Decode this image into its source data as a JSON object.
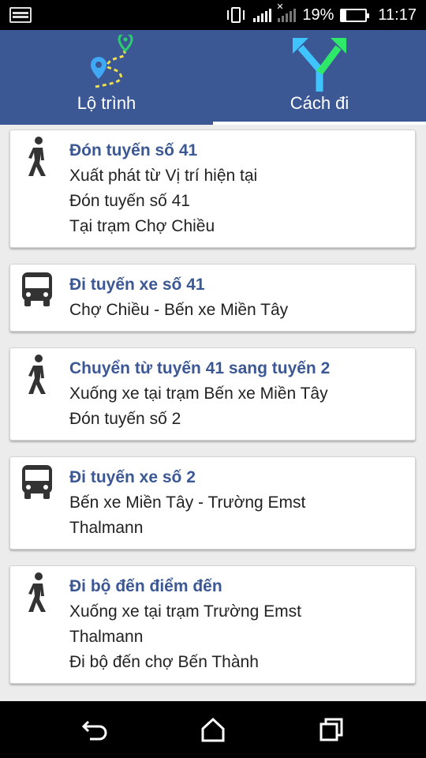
{
  "status_bar": {
    "battery_percent": "19%",
    "battery_level": 0.19,
    "time": "11:17",
    "icons": [
      "notification-icon",
      "vibrate-icon",
      "signal-icon",
      "no-signal-icon",
      "battery-icon"
    ]
  },
  "tabs": [
    {
      "label": "Lộ trình",
      "icon": "route-map-icon",
      "selected": false
    },
    {
      "label": "Cách đi",
      "icon": "fork-arrows-icon",
      "selected": true
    }
  ],
  "colors": {
    "header": "#3b5894",
    "title_text": "#3b5894",
    "route_icon_pin": "#3fa9f5",
    "route_icon_goal": "#2ecc71",
    "route_icon_dots": "#f1e04a",
    "fork_left": "#40c4ff",
    "fork_right": "#2ee86a"
  },
  "steps": [
    {
      "icon": "walking-person-icon",
      "title": "Đón tuyến số 41",
      "lines": [
        "Xuất phát từ Vị trí hiện tại",
        "Đón tuyến số 41",
        "Tại trạm Chợ Chiều"
      ]
    },
    {
      "icon": "bus-icon",
      "title": "Đi tuyến xe số 41",
      "lines": [
        "Chợ Chiều - Bến xe Miền Tây"
      ]
    },
    {
      "icon": "walking-person-icon",
      "title": "Chuyển từ tuyến 41 sang tuyến 2",
      "lines": [
        "Xuống xe tại trạm Bến xe Miền Tây",
        "Đón tuyến số 2"
      ]
    },
    {
      "icon": "bus-icon",
      "title": "Đi tuyến xe số 2",
      "lines": [
        "Bến xe Miền Tây - Trường Emst",
        "Thalmann"
      ]
    },
    {
      "icon": "walking-person-icon",
      "title": "Đi bộ đến điểm đến",
      "lines": [
        "Xuống xe tại trạm Trường Emst",
        "Thalmann",
        "Đi bộ đến chợ Bến Thành"
      ]
    }
  ],
  "nav_bar": {
    "buttons": [
      "back-icon",
      "home-icon",
      "recents-icon"
    ]
  }
}
